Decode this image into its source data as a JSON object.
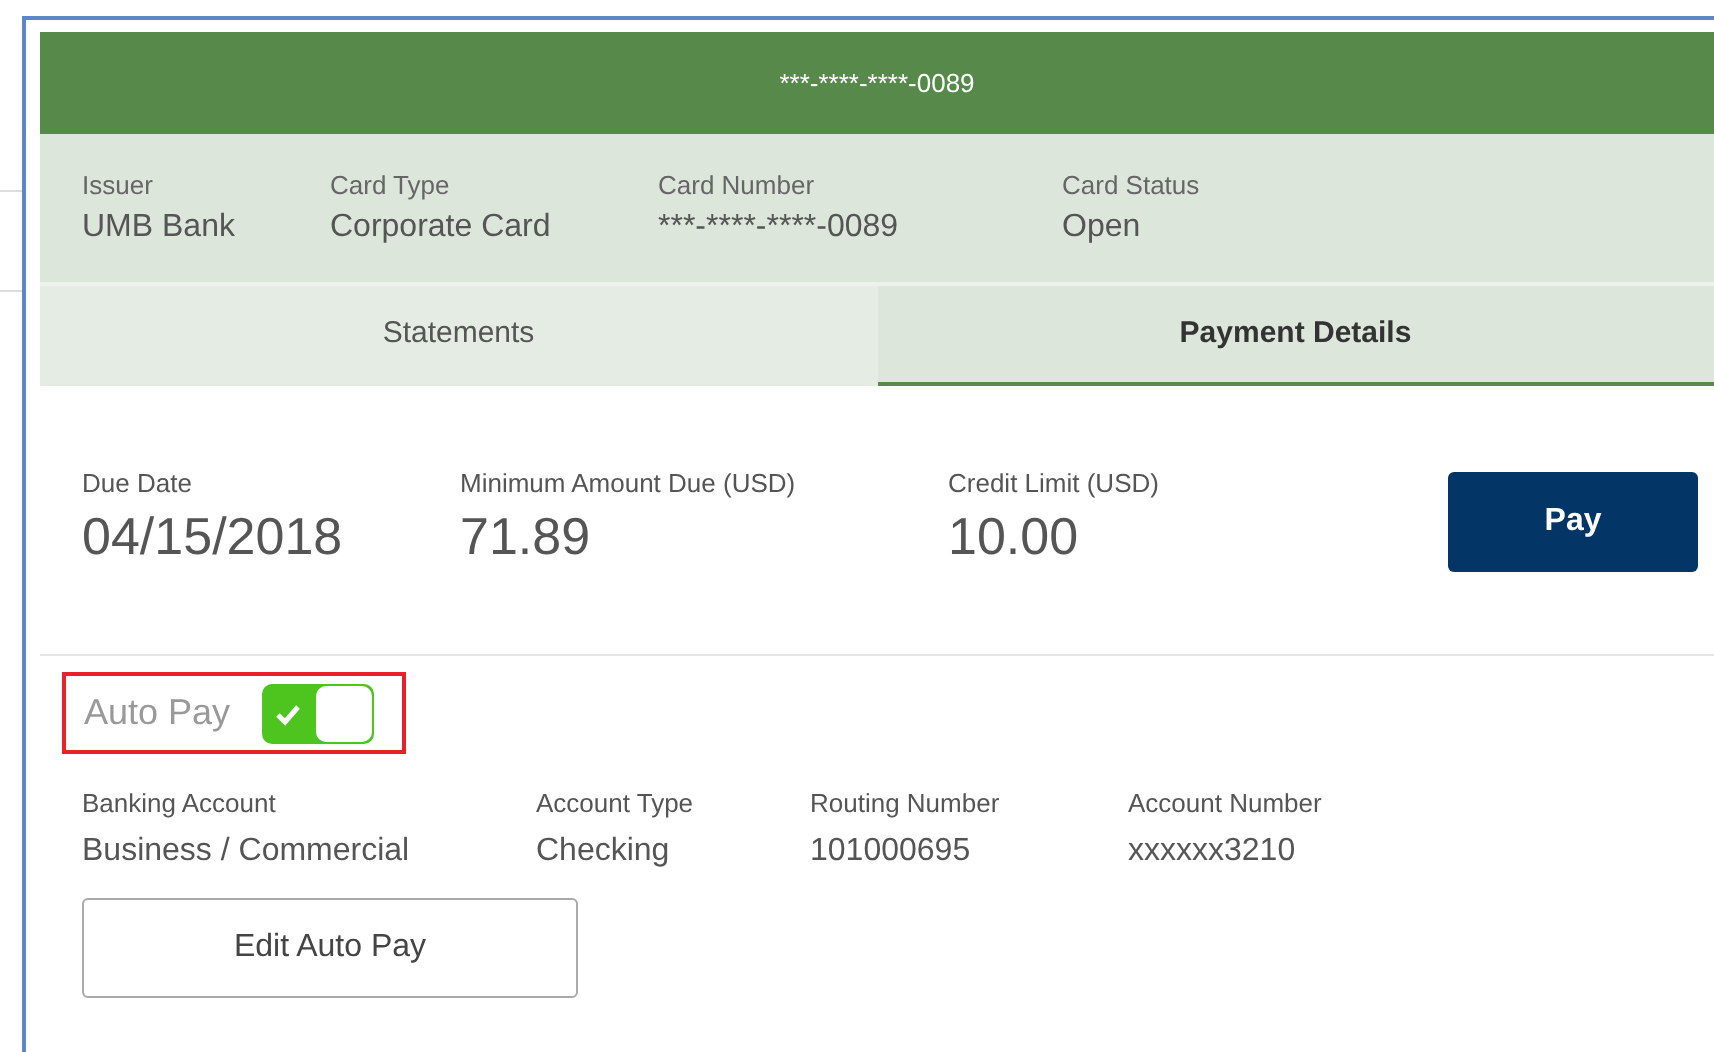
{
  "card_header": {
    "title": "***-****-****-0089"
  },
  "card_info": [
    {
      "label": "Issuer",
      "value": "UMB Bank"
    },
    {
      "label": "Card Type",
      "value": "Corporate Card"
    },
    {
      "label": "Card Number",
      "value": "***-****-****-0089"
    },
    {
      "label": "Card Status",
      "value": "Open"
    }
  ],
  "tabs": [
    {
      "label": "Statements",
      "selected": false
    },
    {
      "label": "Payment Details",
      "selected": true
    }
  ],
  "payment_summary": [
    {
      "label": "Due Date",
      "value": "04/15/2018"
    },
    {
      "label": "Minimum Amount Due (USD)",
      "value": "71.89"
    },
    {
      "label": "Credit Limit (USD)",
      "value": "10.00"
    }
  ],
  "pay_button": "Pay",
  "auto_pay": {
    "label": "Auto Pay",
    "on": true,
    "highlighted": true
  },
  "banking_details": [
    {
      "label": "Banking Account",
      "value": "Business / Commercial"
    },
    {
      "label": "Account Type",
      "value": "Checking"
    },
    {
      "label": "Routing Number",
      "value": "101000695"
    },
    {
      "label": "Account Number",
      "value": "xxxxxx3210"
    }
  ],
  "edit_button": "Edit Auto Pay"
}
